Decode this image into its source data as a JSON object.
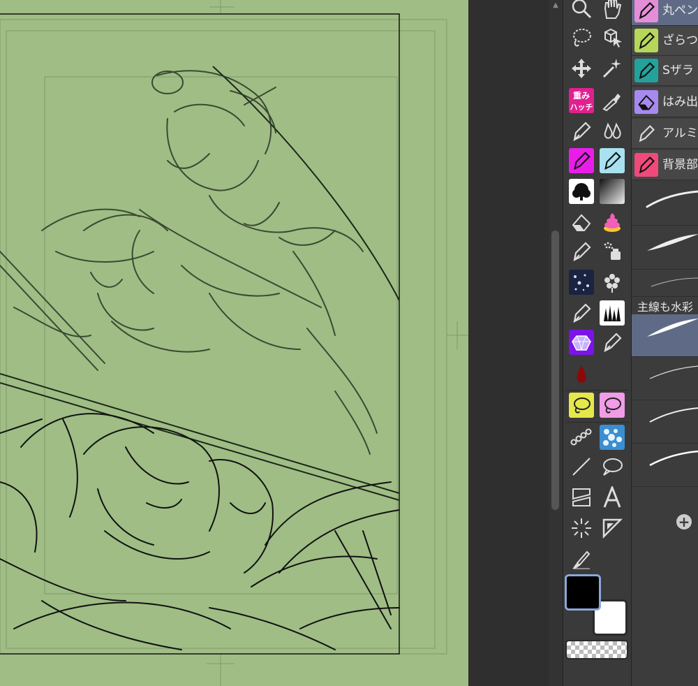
{
  "canvas": {
    "background": "#9fbd85",
    "description_icon": "manga-sketch-canvas"
  },
  "tool_palette": {
    "tools": [
      {
        "name": "zoom-tool",
        "icon": "magnifier-icon"
      },
      {
        "name": "hand-tool",
        "icon": "hand-icon"
      },
      {
        "name": "lasso-tool",
        "icon": "lasso-icon"
      },
      {
        "name": "object-tool",
        "icon": "cube-cursor-icon"
      },
      {
        "name": "move-tool",
        "icon": "move-arrows-icon"
      },
      {
        "name": "auto-select-tool",
        "icon": "magic-wand-icon"
      },
      {
        "name": "custom-hatch-tool",
        "icon": "hatch-badge-icon",
        "badge_text": [
          "重み",
          "ハッチ"
        ]
      },
      {
        "name": "eyedropper-tool",
        "icon": "eyedropper-icon"
      },
      {
        "name": "pen-tool",
        "icon": "pen-icon"
      },
      {
        "name": "water-drop-tool",
        "icon": "drops-icon"
      },
      {
        "name": "magenta-pen-tool",
        "icon": "pen-icon"
      },
      {
        "name": "cyan-pen-tool",
        "icon": "pen-icon"
      },
      {
        "name": "texture-brush-tool",
        "icon": "tree-brush-icon"
      },
      {
        "name": "gradient-tool",
        "icon": "gradient-icon"
      },
      {
        "name": "eraser-tool",
        "icon": "eraser-icon"
      },
      {
        "name": "poop-tool",
        "icon": "poop-icon"
      },
      {
        "name": "pen-tool-2",
        "icon": "pen-icon"
      },
      {
        "name": "airbrush-tool",
        "icon": "airbrush-icon"
      },
      {
        "name": "sparkle-brush-tool",
        "icon": "sparkle-icon"
      },
      {
        "name": "flower-tool",
        "icon": "flower-icon"
      },
      {
        "name": "pen-tool-3",
        "icon": "pen-icon"
      },
      {
        "name": "grass-brush-tool",
        "icon": "grass-icon"
      },
      {
        "name": "gem-tool",
        "icon": "gem-icon"
      },
      {
        "name": "pen-tool-4",
        "icon": "pen-icon"
      },
      {
        "name": "blood-drop-tool",
        "icon": "blood-drop-icon"
      },
      {
        "name": "yellow-lasso-tool",
        "icon": "lasso-fill-icon"
      },
      {
        "name": "pink-lasso-tool",
        "icon": "lasso-fill-icon"
      },
      {
        "name": "chain-tool",
        "icon": "chain-icon"
      },
      {
        "name": "pattern-tool",
        "icon": "pattern-icon"
      },
      {
        "name": "line-tool",
        "icon": "line-icon"
      },
      {
        "name": "balloon-tool",
        "icon": "speech-balloon-icon"
      },
      {
        "name": "frame-tool",
        "icon": "frame-border-icon"
      },
      {
        "name": "text-tool",
        "icon": "text-a-icon"
      },
      {
        "name": "radial-line-tool",
        "icon": "radial-lines-icon"
      },
      {
        "name": "ruler-tool",
        "icon": "ruler-triangle-icon"
      },
      {
        "name": "correct-line-tool",
        "icon": "brush-correct-icon"
      }
    ],
    "main_color": "#000000",
    "sub_color": "#ffffff",
    "transparent_label": "transparent-icon"
  },
  "subtool_panel": {
    "items": [
      {
        "label": "丸ペン",
        "color": "#e58ed8"
      },
      {
        "label": "ざらつき",
        "color": "#b6d65a"
      },
      {
        "label": "Sザラ",
        "color": "#22a29a"
      },
      {
        "label": "はみ出",
        "color": "#a68af0"
      },
      {
        "label": "アルミ箔",
        "color": "#474747"
      },
      {
        "label": "背景部",
        "color": "#f04a7a"
      }
    ],
    "brush_group_label": "主線も水彩",
    "add_icon": "add-circle-icon"
  }
}
